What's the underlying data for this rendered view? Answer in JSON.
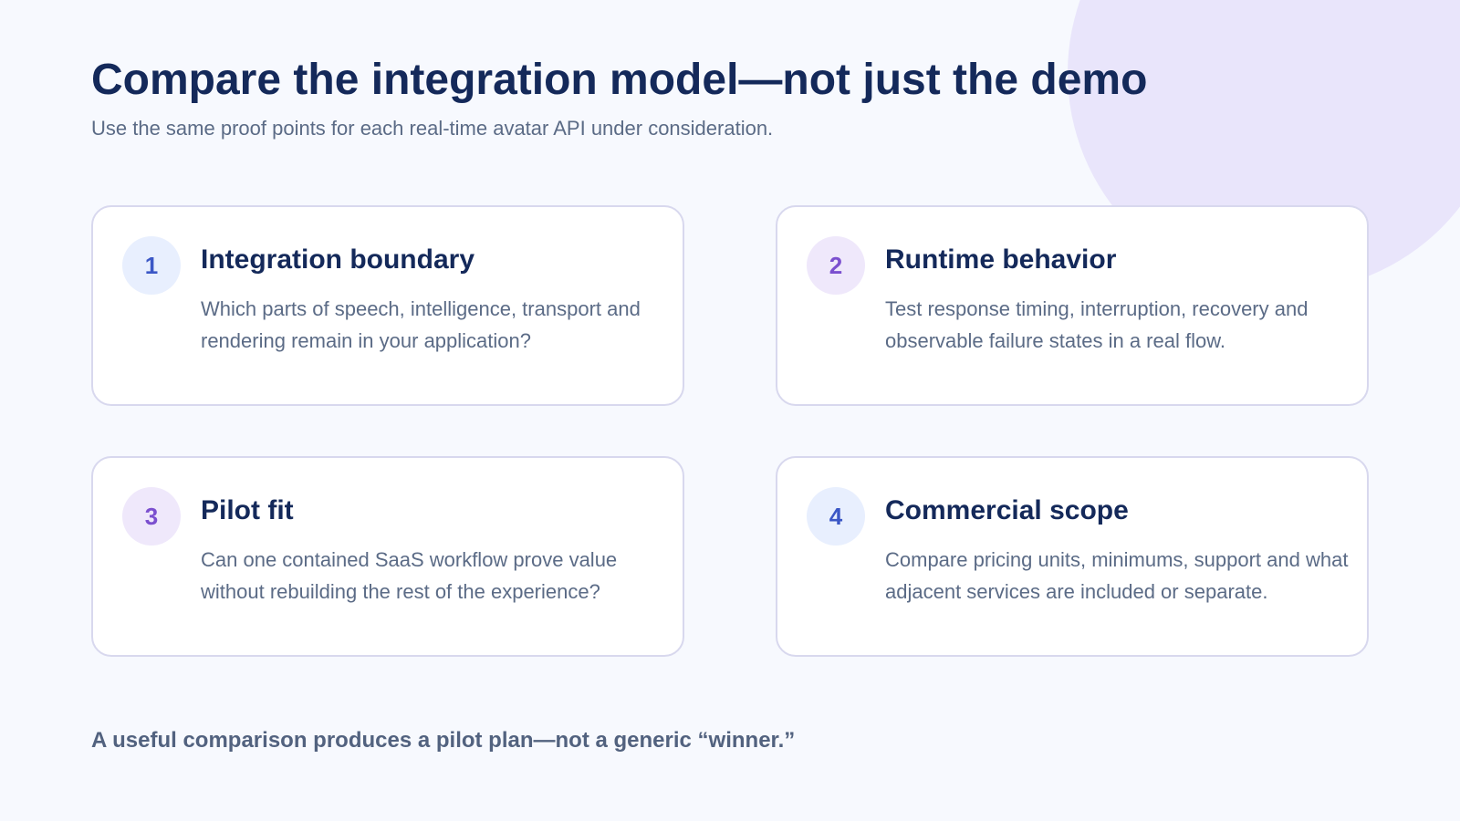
{
  "header": {
    "title": "Compare the integration model—not just the demo",
    "subtitle": "Use the same proof points for each real-time avatar API under consideration."
  },
  "cards": [
    {
      "number": "1",
      "title": "Integration boundary",
      "body": "Which parts of speech, intelligence, transport and rendering remain in your application?"
    },
    {
      "number": "2",
      "title": "Runtime behavior",
      "body": "Test response timing, interruption, recovery and observable failure states in a real flow."
    },
    {
      "number": "3",
      "title": "Pilot fit",
      "body": "Can one contained SaaS workflow prove value without rebuilding the rest of the experience?"
    },
    {
      "number": "4",
      "title": "Commercial scope",
      "body": "Compare pricing units, minimums, support and what adjacent services are included or separate."
    }
  ],
  "footer": {
    "note": "A useful comparison produces a pilot plan—not a generic “winner.”"
  },
  "colors": {
    "background": "#f7f9fe",
    "heading": "#14295a",
    "body_text": "#5b6b86",
    "card_border": "#d8d8ee",
    "decor_circle": "#e9e5fb",
    "badge_blue_bg": "#e8effe",
    "badge_blue_text": "#3b57c6",
    "badge_purple_bg": "#efe8fb",
    "badge_purple_text": "#7b4fcf"
  }
}
